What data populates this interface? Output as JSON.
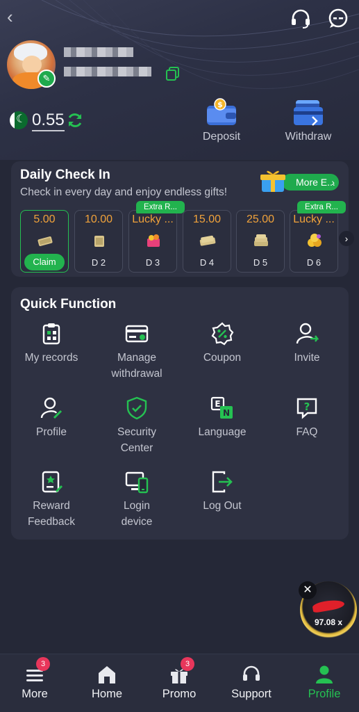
{
  "header": {
    "back_icon": "chevron-left-icon",
    "support_icon": "headset-icon",
    "message_icon": "chat-bubble-icon"
  },
  "profile": {
    "balance": "0.55",
    "country_flag": "pakistan-flag-icon",
    "actions": [
      {
        "label": "Deposit",
        "icon": "wallet-icon"
      },
      {
        "label": "Withdraw",
        "icon": "card-withdraw-icon"
      }
    ]
  },
  "checkin": {
    "title": "Daily Check In",
    "subtitle": "Check in every day and enjoy endless gifts!",
    "more_label": "More E...",
    "days": [
      {
        "amount": "5.00",
        "day": "Claim",
        "claim": true
      },
      {
        "amount": "10.00",
        "day": "D 2"
      },
      {
        "amount": "Lucky ...",
        "day": "D 3",
        "tag": "Extra R..."
      },
      {
        "amount": "15.00",
        "day": "D 4"
      },
      {
        "amount": "25.00",
        "day": "D 5"
      },
      {
        "amount": "Lucky ...",
        "day": "D 6",
        "tag": "Extra R..."
      }
    ]
  },
  "quick": {
    "title": "Quick Function",
    "items": [
      {
        "label1": "My records",
        "label2": ""
      },
      {
        "label1": "Manage",
        "label2": "withdrawal"
      },
      {
        "label1": "Coupon",
        "label2": ""
      },
      {
        "label1": "Invite",
        "label2": ""
      },
      {
        "label1": "Profile",
        "label2": ""
      },
      {
        "label1": "Security",
        "label2": "Center"
      },
      {
        "label1": "Language",
        "label2": ""
      },
      {
        "label1": "FAQ",
        "label2": ""
      },
      {
        "label1": "Reward",
        "label2": "Feedback"
      },
      {
        "label1": "Login",
        "label2": "device"
      },
      {
        "label1": "Log Out",
        "label2": ""
      }
    ]
  },
  "floating_ad": {
    "multiplier": "97.08 x",
    "close": "✕"
  },
  "tabbar": {
    "tabs": [
      {
        "label": "More",
        "badge": "3"
      },
      {
        "label": "Home"
      },
      {
        "label": "Promo",
        "badge": "3"
      },
      {
        "label": "Support"
      },
      {
        "label": "Profile",
        "active": true
      }
    ]
  },
  "colors": {
    "accent": "#25c152",
    "background": "#252837",
    "card": "#2e3142",
    "amount": "#f0a23b",
    "badge": "#e8365b"
  }
}
